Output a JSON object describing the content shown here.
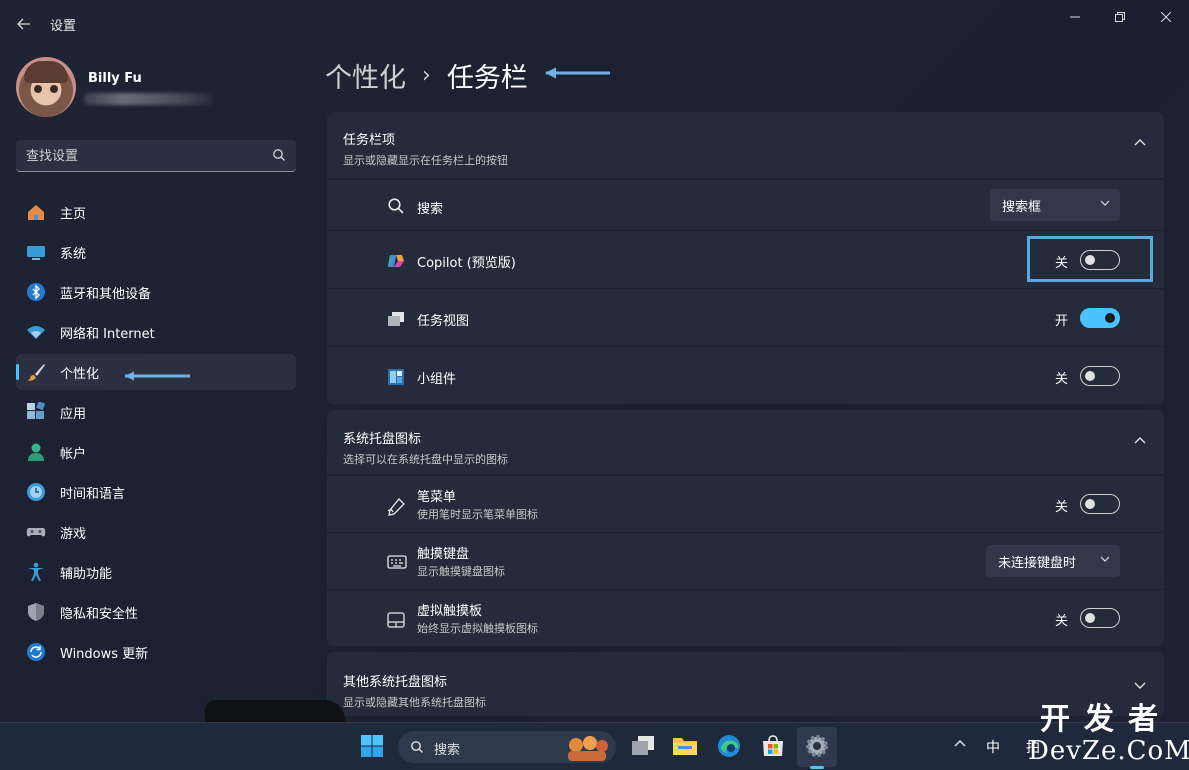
{
  "window": {
    "title": "设置",
    "minimize_icon": "minimize-icon",
    "maximize_icon": "restore-icon",
    "close_icon": "close-icon"
  },
  "profile": {
    "name": "Billy Fu"
  },
  "search": {
    "placeholder": "查找设置"
  },
  "nav": {
    "items": [
      {
        "label": "主页",
        "icon": "home-icon"
      },
      {
        "label": "系统",
        "icon": "system-icon"
      },
      {
        "label": "蓝牙和其他设备",
        "icon": "bluetooth-icon"
      },
      {
        "label": "网络和 Internet",
        "icon": "wifi-icon"
      },
      {
        "label": "个性化",
        "icon": "brush-icon",
        "active": true
      },
      {
        "label": "应用",
        "icon": "apps-icon"
      },
      {
        "label": "帐户",
        "icon": "account-icon"
      },
      {
        "label": "时间和语言",
        "icon": "time-language-icon"
      },
      {
        "label": "游戏",
        "icon": "gamepad-icon"
      },
      {
        "label": "辅助功能",
        "icon": "accessibility-icon"
      },
      {
        "label": "隐私和安全性",
        "icon": "shield-icon"
      },
      {
        "label": "Windows 更新",
        "icon": "update-icon"
      }
    ]
  },
  "breadcrumb": {
    "parent": "个性化",
    "separator": "›",
    "current": "任务栏"
  },
  "sections": {
    "taskbar_items": {
      "title": "任务栏项",
      "subtitle": "显示或隐藏显示在任务栏上的按钮",
      "rows": {
        "search": {
          "label": "搜索",
          "value": "搜索框"
        },
        "copilot": {
          "label": "Copilot (预览版)",
          "state": "关"
        },
        "task_view": {
          "label": "任务视图",
          "state": "开"
        },
        "widgets": {
          "label": "小组件",
          "state": "关"
        }
      }
    },
    "tray_icons": {
      "title": "系统托盘图标",
      "subtitle": "选择可以在系统托盘中显示的图标",
      "rows": {
        "pen_menu": {
          "label": "笔菜单",
          "sub": "使用笔时显示笔菜单图标",
          "state": "关"
        },
        "touch_keyboard": {
          "label": "触摸键盘",
          "sub": "显示触摸键盘图标",
          "value": "未连接键盘时"
        },
        "virtual_touchpad": {
          "label": "虚拟触摸板",
          "sub": "始终显示虚拟触摸板图标",
          "state": "关"
        }
      }
    },
    "other_tray": {
      "title": "其他系统托盘图标",
      "subtitle": "显示或隐藏其他系统托盘图标"
    }
  },
  "taskbar": {
    "search_label": "搜索",
    "ime_label": "中",
    "ime_label2": "拍"
  },
  "watermark": {
    "line1": "开发者",
    "line2": "DevZe.CoM"
  },
  "colors": {
    "accent": "#4cc2ff",
    "background": "#1d2233",
    "card": "#262b3b",
    "highlight_box": "#5aa8e0"
  }
}
